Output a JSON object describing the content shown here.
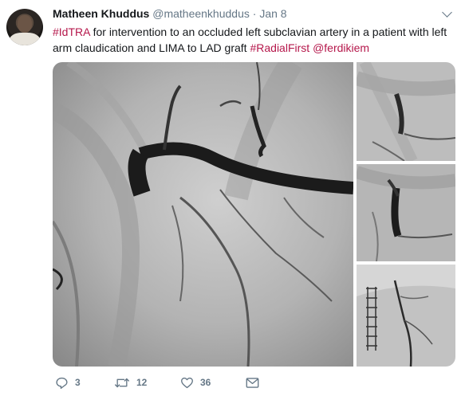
{
  "tweet": {
    "display_name": "Matheen Khuddus",
    "handle": "@matheenkhuddus",
    "separator": "·",
    "date": "Jan 8",
    "text_parts": [
      {
        "text": "#IdTRA",
        "tag": true
      },
      {
        "text": " for intervention to an occluded left subclavian artery in a patient with left arm claudication and LIMA to LAD graft ",
        "tag": false
      },
      {
        "text": "#RadialFirst",
        "tag": true
      },
      {
        "text": " ",
        "tag": false
      },
      {
        "text": "@ferdikiem",
        "tag": true
      }
    ],
    "media": {
      "images": [
        {
          "name": "angiogram-main",
          "icon": "angiogram-image"
        },
        {
          "name": "angiogram-thumb-1",
          "icon": "angiogram-image"
        },
        {
          "name": "angiogram-thumb-2",
          "icon": "angiogram-image"
        },
        {
          "name": "angiogram-thumb-3",
          "icon": "angiogram-image"
        }
      ]
    },
    "actions": {
      "reply": {
        "icon": "reply-icon",
        "count": "3"
      },
      "retweet": {
        "icon": "retweet-icon",
        "count": "12"
      },
      "like": {
        "icon": "heart-icon",
        "count": "36"
      },
      "message": {
        "icon": "envelope-icon"
      }
    }
  },
  "colors": {
    "accent": "#b5174b",
    "muted": "#657786",
    "text": "#14171a"
  }
}
